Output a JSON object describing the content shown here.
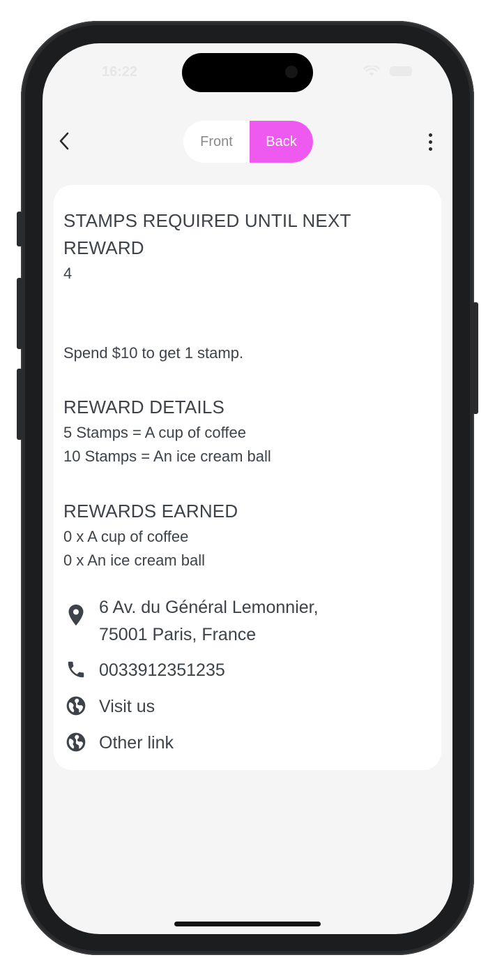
{
  "status_bar": {
    "time": "16:22"
  },
  "nav": {
    "tabs": [
      {
        "label": "Front",
        "selected": false
      },
      {
        "label": "Back",
        "selected": true
      }
    ],
    "back_icon": "chevron-left-icon",
    "more_icon": "vertical-ellipsis-icon"
  },
  "card": {
    "stamps_heading": "STAMPS REQUIRED UNTIL NEXT REWARD",
    "stamps_value": "4",
    "spend_rule": "Spend $10 to get 1 stamp.",
    "reward_details_heading": "REWARD DETAILS",
    "reward_details": [
      "5 Stamps = A cup of coffee",
      "10 Stamps = An ice cream ball"
    ],
    "rewards_earned_heading": "REWARDS EARNED",
    "rewards_earned": [
      "0 x A cup of coffee",
      "0 x An ice cream ball"
    ]
  },
  "contacts": {
    "address_line1": "6 Av. du Général Lemonnier,",
    "address_line2": "75001 Paris, France",
    "phone": "0033912351235",
    "visit_label": "Visit us",
    "other_link_label": "Other link",
    "icons": [
      "location-pin-icon",
      "phone-icon",
      "globe-icon",
      "globe-icon"
    ]
  },
  "colors": {
    "accent": "#ee5af0",
    "text": "#3d4349",
    "background": "#f5f5f5",
    "card": "#ffffff"
  }
}
